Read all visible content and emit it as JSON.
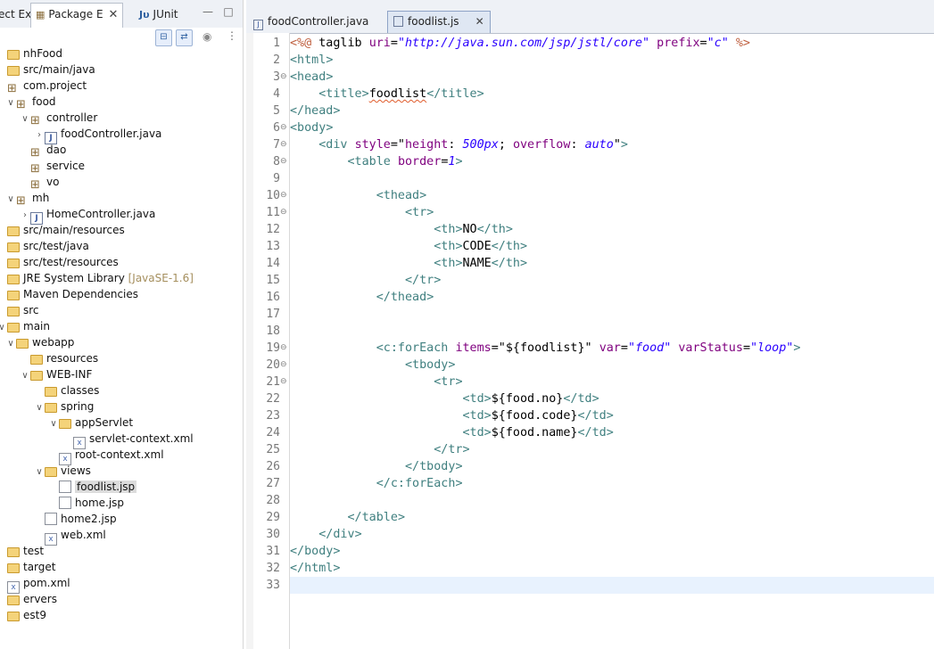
{
  "left_tabs": {
    "tab1": "ect Ex",
    "tab2": "Package E",
    "tab3": "JUnit"
  },
  "tree": [
    {
      "label": "nhFood",
      "indent": 0
    },
    {
      "label": "src/main/java",
      "indent": 0
    },
    {
      "label": "com.project",
      "indent": 0
    },
    {
      "label": "food",
      "indent": 1
    },
    {
      "label": "controller",
      "indent": 2
    },
    {
      "label": "foodController.java",
      "indent": 3
    },
    {
      "label": "dao",
      "indent": 2
    },
    {
      "label": "service",
      "indent": 2
    },
    {
      "label": "vo",
      "indent": 2
    },
    {
      "label": "mh",
      "indent": 1
    },
    {
      "label": "HomeController.java",
      "indent": 2
    },
    {
      "label": "src/main/resources",
      "indent": 0
    },
    {
      "label": "src/test/java",
      "indent": 0
    },
    {
      "label": "src/test/resources",
      "indent": 0
    },
    {
      "label": "JRE System Library",
      "decor": "[JavaSE-1.6]",
      "indent": 0
    },
    {
      "label": "Maven Dependencies",
      "indent": 0
    },
    {
      "label": "src",
      "indent": 0
    },
    {
      "label": "main",
      "indent": 0
    },
    {
      "label": "webapp",
      "indent": 1
    },
    {
      "label": "resources",
      "indent": 2
    },
    {
      "label": "WEB-INF",
      "indent": 2
    },
    {
      "label": "classes",
      "indent": 3
    },
    {
      "label": "spring",
      "indent": 3
    },
    {
      "label": "appServlet",
      "indent": 4
    },
    {
      "label": "servlet-context.xml",
      "indent": 5
    },
    {
      "label": "root-context.xml",
      "indent": 4
    },
    {
      "label": "views",
      "indent": 3
    },
    {
      "label": "foodlist.jsp",
      "indent": 4,
      "selected": true
    },
    {
      "label": "home.jsp",
      "indent": 4
    },
    {
      "label": "home2.jsp",
      "indent": 3
    },
    {
      "label": "web.xml",
      "indent": 3
    },
    {
      "label": "test",
      "indent": 0
    },
    {
      "label": "target",
      "indent": 0
    },
    {
      "label": "pom.xml",
      "indent": 0
    },
    {
      "label": "ervers",
      "indent": 0
    },
    {
      "label": "est9",
      "indent": 0
    }
  ],
  "editor_tabs": {
    "tab1": "foodController.java",
    "tab2": "foodlist.js"
  },
  "code": [
    "<%@ taglib uri=\"http://java.sun.com/jsp/jstl/core\" prefix=\"c\" %>",
    "<html>",
    "<head>",
    "    <title>foodlist</title>",
    "</head>",
    "<body>",
    "    <div style=\"height: 500px; overflow: auto\">",
    "        <table border=1>",
    "",
    "            <thead>",
    "                <tr>",
    "                    <th>NO</th>",
    "                    <th>CODE</th>",
    "                    <th>NAME</th>",
    "                </tr>",
    "            </thead>",
    "",
    "",
    "            <c:forEach items=\"${foodlist}\" var=\"food\" varStatus=\"loop\">",
    "                <tbody>",
    "                    <tr>",
    "                        <td>${food.no}</td>",
    "                        <td>${food.code}</td>",
    "                        <td>${food.name}</td>",
    "                    </tr>",
    "                </tbody>",
    "            </c:forEach>",
    "",
    "        </table>",
    "    </div>",
    "</body>",
    "</html>",
    ""
  ],
  "folded_lines": [
    3,
    6,
    7,
    8,
    10,
    11,
    19,
    20,
    21
  ],
  "current_line": 33,
  "colors": {
    "tag": "#3f7f7f",
    "attribute": "#7f007f",
    "value": "#2a00ff",
    "directive": "#bf5f3f"
  }
}
